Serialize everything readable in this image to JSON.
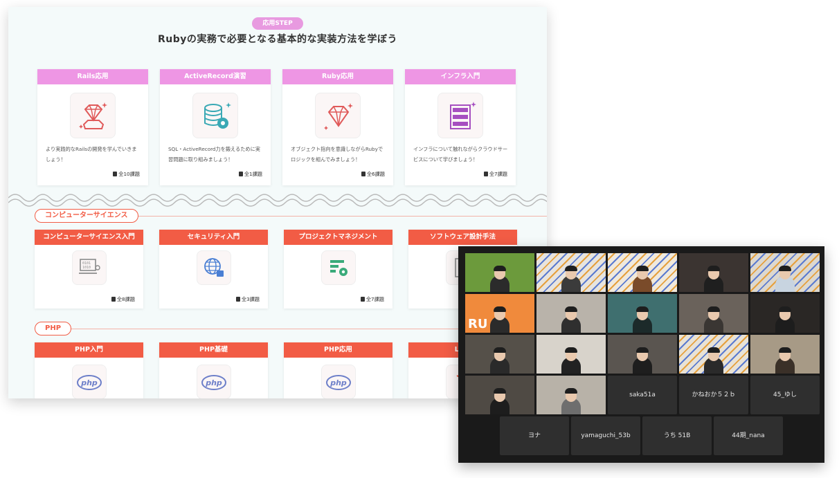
{
  "panel": {
    "step_badge": "応用STEP",
    "title": "Rubyの実務で必要となる基本的な実装方法を学ぼう",
    "top_cards": [
      {
        "title": "Rails応用",
        "icon": "ruby-gem-icon",
        "desc": "より実践的なRailsの開発を学んでいきましょう！",
        "count": "全10課題",
        "color": "#e05a5a"
      },
      {
        "title": "ActiveRecord演習",
        "icon": "database-gear-icon",
        "desc": "SQL・ActiveRecord力を鍛えるために実習問題に取り組みましょう！",
        "count": "全1課題",
        "color": "#3aa9b5"
      },
      {
        "title": "Ruby応用",
        "icon": "ruby-gem-icon",
        "desc": "オブジェクト指向を意識しながらRubyでロジックを組んでみましょう！",
        "count": "全6課題",
        "color": "#e05a5a"
      },
      {
        "title": "インフラ入門",
        "icon": "server-rack-icon",
        "desc": "インフラについて触れながらクラウドサービスについて学びましょう！",
        "count": "全7課題",
        "color": "#a64fc0"
      }
    ],
    "section_cs": {
      "label": "コンピューターサイエンス",
      "cards": [
        {
          "title": "コンピューターサイエンス入門",
          "icon": "laptop-binary-icon",
          "count": "全8課題",
          "color": "#8a8a8a"
        },
        {
          "title": "セキュリティ入門",
          "icon": "globe-lock-icon",
          "count": "全3課題",
          "color": "#4a7fd4"
        },
        {
          "title": "プロジェクトマネジメント",
          "icon": "gantt-gear-icon",
          "count": "全7課題",
          "color": "#3aaa7a"
        },
        {
          "title": "ソフトウェア設計手法",
          "icon": "design-doc-icon",
          "count": "",
          "color": "#8a8a8a"
        }
      ]
    },
    "section_php": {
      "label": "PHP",
      "cards": [
        {
          "title": "PHP入門",
          "icon": "php-logo-icon"
        },
        {
          "title": "PHP基礎",
          "icon": "php-logo-icon"
        },
        {
          "title": "PHP応用",
          "icon": "php-logo-icon"
        },
        {
          "title": "Lara",
          "icon": "laravel-logo-icon"
        }
      ]
    }
  },
  "call": {
    "video_tiles": [
      {
        "bg": "#6c9a3c",
        "shirt": "#2b2b2b"
      },
      {
        "bg": "#e7e4de",
        "shirt": "#3b3b3b",
        "pattern": true
      },
      {
        "bg": "#f0e9dc",
        "shirt": "#7a4b2a",
        "pattern": true
      },
      {
        "bg": "#3b3431",
        "shirt": "#1f1f1f"
      },
      {
        "bg": "#dcd8cf",
        "shirt": "#c8d4e0",
        "pattern": true
      },
      {
        "bg": "#f08a3c",
        "shirt": "#2b2b2b",
        "banner": "RU"
      },
      {
        "bg": "#b9b3aa",
        "shirt": "#2f2f2f"
      },
      {
        "bg": "#3f6f6f",
        "shirt": "#1c2a2a"
      },
      {
        "bg": "#6a625b",
        "shirt": "#3a3633"
      },
      {
        "bg": "#2a2725",
        "shirt": "#1d1d1d"
      },
      {
        "bg": "#555049",
        "shirt": "#2a2a2a"
      },
      {
        "bg": "#d8d3cb",
        "shirt": "#222222"
      },
      {
        "bg": "#5a5550",
        "shirt": "#1e1e1e"
      },
      {
        "bg": "#e8e2d6",
        "shirt": "#2a2a2a",
        "pattern": true
      },
      {
        "bg": "#a79a86",
        "shirt": "#3a3028"
      },
      {
        "bg": "#4f4a44",
        "shirt": "#1d1d1d"
      },
      {
        "bg": "#b8b2a8",
        "shirt": "#6e6e6e"
      }
    ],
    "name_tiles_row4": [
      "saka51a",
      "かねおか５２ｂ",
      "45_ゆし"
    ],
    "name_tiles_row5": [
      "ヨナ",
      "yamaguchi_53b",
      "うち 51B",
      "44期_nana"
    ]
  }
}
